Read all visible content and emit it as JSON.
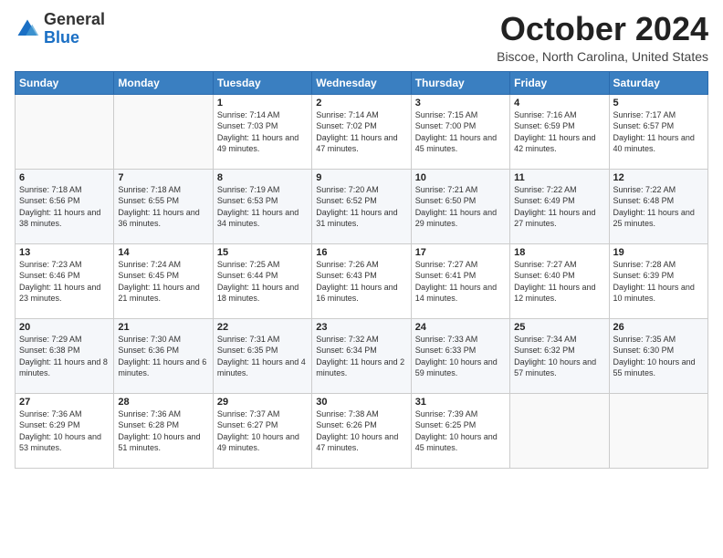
{
  "header": {
    "logo_general": "General",
    "logo_blue": "Blue",
    "title": "October 2024",
    "location": "Biscoe, North Carolina, United States"
  },
  "weekdays": [
    "Sunday",
    "Monday",
    "Tuesday",
    "Wednesday",
    "Thursday",
    "Friday",
    "Saturday"
  ],
  "weeks": [
    [
      {
        "day": "",
        "sunrise": "",
        "sunset": "",
        "daylight": ""
      },
      {
        "day": "",
        "sunrise": "",
        "sunset": "",
        "daylight": ""
      },
      {
        "day": "1",
        "sunrise": "Sunrise: 7:14 AM",
        "sunset": "Sunset: 7:03 PM",
        "daylight": "Daylight: 11 hours and 49 minutes."
      },
      {
        "day": "2",
        "sunrise": "Sunrise: 7:14 AM",
        "sunset": "Sunset: 7:02 PM",
        "daylight": "Daylight: 11 hours and 47 minutes."
      },
      {
        "day": "3",
        "sunrise": "Sunrise: 7:15 AM",
        "sunset": "Sunset: 7:00 PM",
        "daylight": "Daylight: 11 hours and 45 minutes."
      },
      {
        "day": "4",
        "sunrise": "Sunrise: 7:16 AM",
        "sunset": "Sunset: 6:59 PM",
        "daylight": "Daylight: 11 hours and 42 minutes."
      },
      {
        "day": "5",
        "sunrise": "Sunrise: 7:17 AM",
        "sunset": "Sunset: 6:57 PM",
        "daylight": "Daylight: 11 hours and 40 minutes."
      }
    ],
    [
      {
        "day": "6",
        "sunrise": "Sunrise: 7:18 AM",
        "sunset": "Sunset: 6:56 PM",
        "daylight": "Daylight: 11 hours and 38 minutes."
      },
      {
        "day": "7",
        "sunrise": "Sunrise: 7:18 AM",
        "sunset": "Sunset: 6:55 PM",
        "daylight": "Daylight: 11 hours and 36 minutes."
      },
      {
        "day": "8",
        "sunrise": "Sunrise: 7:19 AM",
        "sunset": "Sunset: 6:53 PM",
        "daylight": "Daylight: 11 hours and 34 minutes."
      },
      {
        "day": "9",
        "sunrise": "Sunrise: 7:20 AM",
        "sunset": "Sunset: 6:52 PM",
        "daylight": "Daylight: 11 hours and 31 minutes."
      },
      {
        "day": "10",
        "sunrise": "Sunrise: 7:21 AM",
        "sunset": "Sunset: 6:50 PM",
        "daylight": "Daylight: 11 hours and 29 minutes."
      },
      {
        "day": "11",
        "sunrise": "Sunrise: 7:22 AM",
        "sunset": "Sunset: 6:49 PM",
        "daylight": "Daylight: 11 hours and 27 minutes."
      },
      {
        "day": "12",
        "sunrise": "Sunrise: 7:22 AM",
        "sunset": "Sunset: 6:48 PM",
        "daylight": "Daylight: 11 hours and 25 minutes."
      }
    ],
    [
      {
        "day": "13",
        "sunrise": "Sunrise: 7:23 AM",
        "sunset": "Sunset: 6:46 PM",
        "daylight": "Daylight: 11 hours and 23 minutes."
      },
      {
        "day": "14",
        "sunrise": "Sunrise: 7:24 AM",
        "sunset": "Sunset: 6:45 PM",
        "daylight": "Daylight: 11 hours and 21 minutes."
      },
      {
        "day": "15",
        "sunrise": "Sunrise: 7:25 AM",
        "sunset": "Sunset: 6:44 PM",
        "daylight": "Daylight: 11 hours and 18 minutes."
      },
      {
        "day": "16",
        "sunrise": "Sunrise: 7:26 AM",
        "sunset": "Sunset: 6:43 PM",
        "daylight": "Daylight: 11 hours and 16 minutes."
      },
      {
        "day": "17",
        "sunrise": "Sunrise: 7:27 AM",
        "sunset": "Sunset: 6:41 PM",
        "daylight": "Daylight: 11 hours and 14 minutes."
      },
      {
        "day": "18",
        "sunrise": "Sunrise: 7:27 AM",
        "sunset": "Sunset: 6:40 PM",
        "daylight": "Daylight: 11 hours and 12 minutes."
      },
      {
        "day": "19",
        "sunrise": "Sunrise: 7:28 AM",
        "sunset": "Sunset: 6:39 PM",
        "daylight": "Daylight: 11 hours and 10 minutes."
      }
    ],
    [
      {
        "day": "20",
        "sunrise": "Sunrise: 7:29 AM",
        "sunset": "Sunset: 6:38 PM",
        "daylight": "Daylight: 11 hours and 8 minutes."
      },
      {
        "day": "21",
        "sunrise": "Sunrise: 7:30 AM",
        "sunset": "Sunset: 6:36 PM",
        "daylight": "Daylight: 11 hours and 6 minutes."
      },
      {
        "day": "22",
        "sunrise": "Sunrise: 7:31 AM",
        "sunset": "Sunset: 6:35 PM",
        "daylight": "Daylight: 11 hours and 4 minutes."
      },
      {
        "day": "23",
        "sunrise": "Sunrise: 7:32 AM",
        "sunset": "Sunset: 6:34 PM",
        "daylight": "Daylight: 11 hours and 2 minutes."
      },
      {
        "day": "24",
        "sunrise": "Sunrise: 7:33 AM",
        "sunset": "Sunset: 6:33 PM",
        "daylight": "Daylight: 10 hours and 59 minutes."
      },
      {
        "day": "25",
        "sunrise": "Sunrise: 7:34 AM",
        "sunset": "Sunset: 6:32 PM",
        "daylight": "Daylight: 10 hours and 57 minutes."
      },
      {
        "day": "26",
        "sunrise": "Sunrise: 7:35 AM",
        "sunset": "Sunset: 6:30 PM",
        "daylight": "Daylight: 10 hours and 55 minutes."
      }
    ],
    [
      {
        "day": "27",
        "sunrise": "Sunrise: 7:36 AM",
        "sunset": "Sunset: 6:29 PM",
        "daylight": "Daylight: 10 hours and 53 minutes."
      },
      {
        "day": "28",
        "sunrise": "Sunrise: 7:36 AM",
        "sunset": "Sunset: 6:28 PM",
        "daylight": "Daylight: 10 hours and 51 minutes."
      },
      {
        "day": "29",
        "sunrise": "Sunrise: 7:37 AM",
        "sunset": "Sunset: 6:27 PM",
        "daylight": "Daylight: 10 hours and 49 minutes."
      },
      {
        "day": "30",
        "sunrise": "Sunrise: 7:38 AM",
        "sunset": "Sunset: 6:26 PM",
        "daylight": "Daylight: 10 hours and 47 minutes."
      },
      {
        "day": "31",
        "sunrise": "Sunrise: 7:39 AM",
        "sunset": "Sunset: 6:25 PM",
        "daylight": "Daylight: 10 hours and 45 minutes."
      },
      {
        "day": "",
        "sunrise": "",
        "sunset": "",
        "daylight": ""
      },
      {
        "day": "",
        "sunrise": "",
        "sunset": "",
        "daylight": ""
      }
    ]
  ]
}
